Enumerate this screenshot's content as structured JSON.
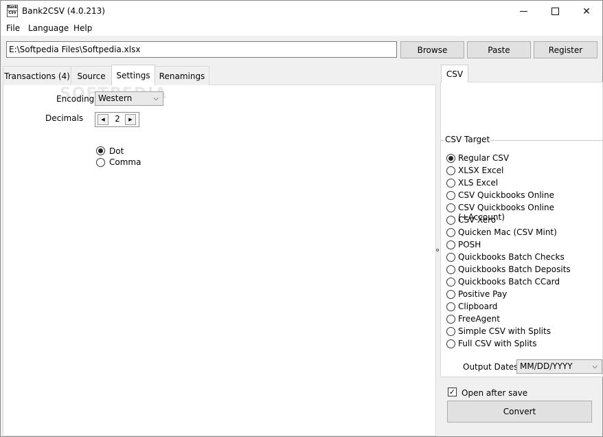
{
  "window": {
    "title": "Bank2CSV (4.0.213)",
    "icon_lines": [
      "Bank",
      "CSV"
    ]
  },
  "menu": [
    "File",
    "Language",
    "Help"
  ],
  "path": {
    "value": "E:\\Softpedia Files\\Softpedia.xlsx"
  },
  "buttons": {
    "browse": "Browse",
    "paste": "Paste",
    "register": "Register",
    "convert": "Convert"
  },
  "tabs": [
    "Transactions (4)",
    "Source",
    "Settings",
    "Renamings"
  ],
  "active_tab": "Settings",
  "settings": {
    "encoding_label": "Encoding:",
    "encoding_value": "Western",
    "decimals_label": "Decimals",
    "decimals_value": "2",
    "separator_options": [
      {
        "label": "Dot",
        "checked": true
      },
      {
        "label": "Comma",
        "checked": false
      }
    ]
  },
  "watermark": "SOFTPEDIA",
  "right_tab": "CSV",
  "csv_target": {
    "title": "CSV Target",
    "options": [
      {
        "label": "Regular CSV",
        "checked": true
      },
      {
        "label": "XLSX Excel",
        "checked": false
      },
      {
        "label": "XLS Excel",
        "checked": false
      },
      {
        "label": "CSV Quickbooks Online",
        "checked": false
      },
      {
        "label": "CSV Quickbooks Online (+Account)",
        "checked": false
      },
      {
        "label": "CSV Xero",
        "checked": false
      },
      {
        "label": "Quicken Mac (CSV Mint)",
        "checked": false
      },
      {
        "label": "POSH",
        "checked": false
      },
      {
        "label": "Quickbooks Batch Checks",
        "checked": false
      },
      {
        "label": "Quickbooks Batch Deposits",
        "checked": false
      },
      {
        "label": "Quickbooks Batch CCard",
        "checked": false
      },
      {
        "label": "Positive Pay",
        "checked": false
      },
      {
        "label": "Clipboard",
        "checked": false
      },
      {
        "label": "FreeAgent",
        "checked": false
      },
      {
        "label": "Simple CSV with Splits",
        "checked": false
      },
      {
        "label": "Full CSV with Splits",
        "checked": false
      }
    ]
  },
  "output_dates": {
    "label": "Output Dates:",
    "value": "MM/DD/YYYY"
  },
  "open_after_save": {
    "label": "Open after save",
    "checked": true
  }
}
